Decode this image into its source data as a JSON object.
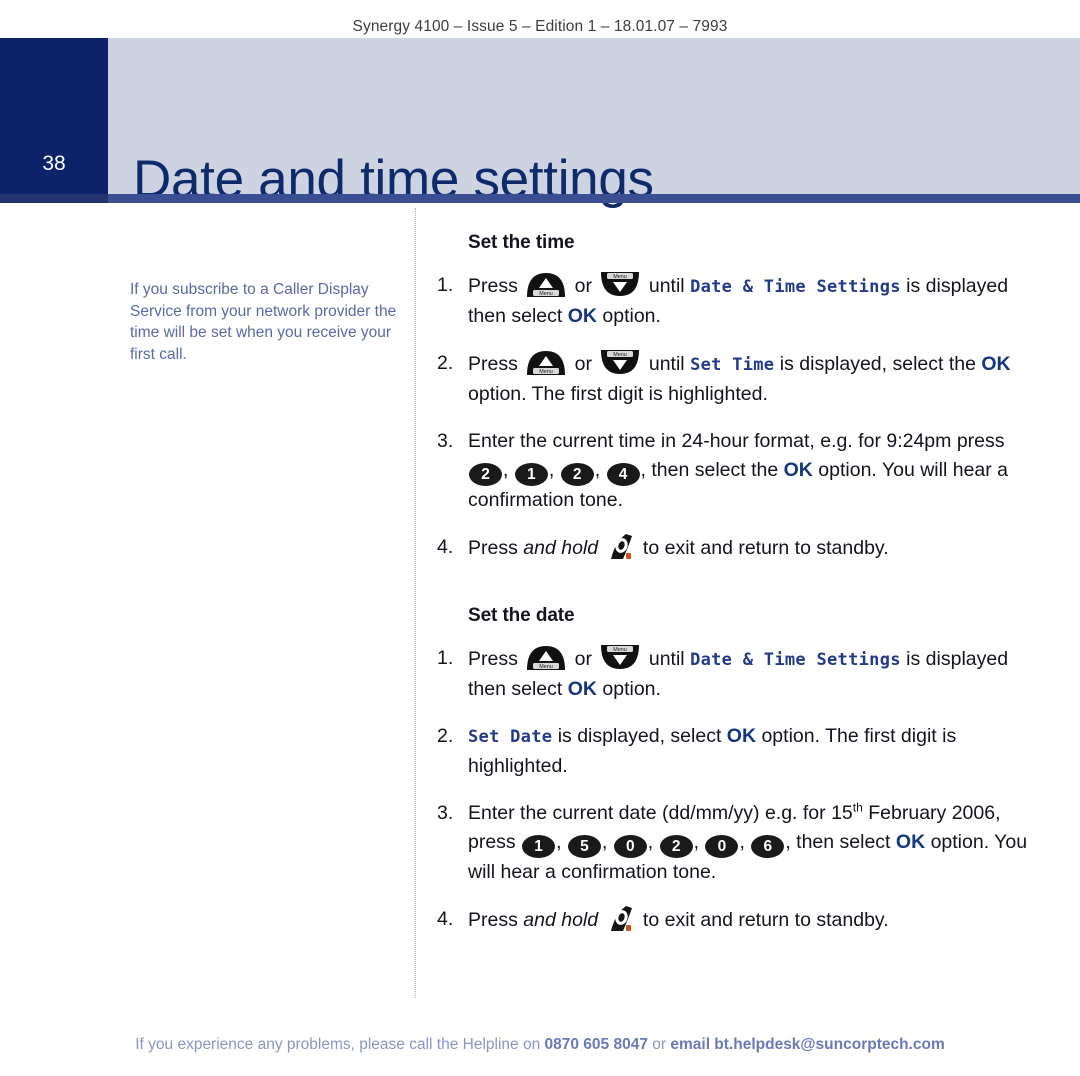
{
  "header": {
    "running_head": "Synergy 4100 – Issue 5 – Edition 1 – 18.01.07 – 7993"
  },
  "banner": {
    "page_number": "38",
    "title": "Date and time settings",
    "bg_color": "#ced3e2",
    "page_box_color": "#0d2369",
    "title_color": "#0d2a6b",
    "rule_color": "#3a4f91"
  },
  "side_note": {
    "text": "If you subscribe to a Caller Display Service from your network provider the time will be set when you receive your first call.",
    "color": "#5a6aa8"
  },
  "sections": [
    {
      "heading": "Set the time",
      "steps": [
        {
          "number": "1.",
          "parts": [
            {
              "type": "text",
              "value": "Press "
            },
            {
              "type": "icon",
              "icon": "menu-up-key",
              "label": "Menu"
            },
            {
              "type": "text",
              "value": " or "
            },
            {
              "type": "icon",
              "icon": "menu-down-key",
              "label": "Menu"
            },
            {
              "type": "text",
              "value": " until "
            },
            {
              "type": "lcd",
              "value": "Date & Time Settings"
            },
            {
              "type": "text",
              "value": " is displayed then select "
            },
            {
              "type": "ok",
              "value": "OK"
            },
            {
              "type": "text",
              "value": " option."
            }
          ]
        },
        {
          "number": "2.",
          "parts": [
            {
              "type": "text",
              "value": "Press "
            },
            {
              "type": "icon",
              "icon": "menu-up-key",
              "label": "Menu"
            },
            {
              "type": "text",
              "value": " or "
            },
            {
              "type": "icon",
              "icon": "menu-down-key",
              "label": "Menu"
            },
            {
              "type": "text",
              "value": " until "
            },
            {
              "type": "lcd",
              "value": "Set Time"
            },
            {
              "type": "text",
              "value": " is displayed, select the "
            },
            {
              "type": "ok",
              "value": "OK"
            },
            {
              "type": "text",
              "value": " option. The first digit is highlighted."
            }
          ]
        },
        {
          "number": "3.",
          "parts": [
            {
              "type": "text",
              "value": "Enter the current time in 24-hour format, e.g. for 9:24pm press "
            },
            {
              "type": "digit",
              "value": "2"
            },
            {
              "type": "text",
              "value": ", "
            },
            {
              "type": "digit",
              "value": "1"
            },
            {
              "type": "text",
              "value": ", "
            },
            {
              "type": "digit",
              "value": "2"
            },
            {
              "type": "text",
              "value": ", "
            },
            {
              "type": "digit",
              "value": "4"
            },
            {
              "type": "text",
              "value": ", then select the "
            },
            {
              "type": "ok",
              "value": "OK"
            },
            {
              "type": "text",
              "value": " option. You will hear a confirmation tone."
            }
          ]
        },
        {
          "number": "4.",
          "parts": [
            {
              "type": "text",
              "value": "Press "
            },
            {
              "type": "italic",
              "value": "and hold"
            },
            {
              "type": "text",
              "value": " "
            },
            {
              "type": "icon",
              "icon": "hangup-handset-key"
            },
            {
              "type": "text",
              "value": " to exit and return to standby."
            }
          ]
        }
      ]
    },
    {
      "heading": "Set the date",
      "steps": [
        {
          "number": "1.",
          "parts": [
            {
              "type": "text",
              "value": "Press "
            },
            {
              "type": "icon",
              "icon": "menu-up-key",
              "label": "Menu"
            },
            {
              "type": "text",
              "value": " or "
            },
            {
              "type": "icon",
              "icon": "menu-down-key",
              "label": "Menu"
            },
            {
              "type": "text",
              "value": " until "
            },
            {
              "type": "lcd",
              "value": "Date & Time Settings"
            },
            {
              "type": "text",
              "value": " is displayed then select "
            },
            {
              "type": "ok",
              "value": "OK"
            },
            {
              "type": "text",
              "value": " option."
            }
          ]
        },
        {
          "number": "2.",
          "parts": [
            {
              "type": "lcd",
              "value": "Set Date"
            },
            {
              "type": "text",
              "value": " is displayed, select "
            },
            {
              "type": "ok",
              "value": "OK"
            },
            {
              "type": "text",
              "value": " option. The first digit is highlighted."
            }
          ]
        },
        {
          "number": "3.",
          "parts": [
            {
              "type": "text",
              "value": "Enter the current date (dd/mm/yy) e.g. for 15"
            },
            {
              "type": "sup",
              "value": "th"
            },
            {
              "type": "text",
              "value": " February 2006, press "
            },
            {
              "type": "digit",
              "value": "1"
            },
            {
              "type": "text",
              "value": ", "
            },
            {
              "type": "digit",
              "value": "5"
            },
            {
              "type": "text",
              "value": ", "
            },
            {
              "type": "digit",
              "value": "0"
            },
            {
              "type": "text",
              "value": ", "
            },
            {
              "type": "digit",
              "value": "2"
            },
            {
              "type": "text",
              "value": ", "
            },
            {
              "type": "digit",
              "value": "0"
            },
            {
              "type": "text",
              "value": ", "
            },
            {
              "type": "digit",
              "value": "6"
            },
            {
              "type": "text",
              "value": ", then select "
            },
            {
              "type": "ok",
              "value": "OK"
            },
            {
              "type": "text",
              "value": " option. You will hear a confirmation tone."
            }
          ]
        },
        {
          "number": "4.",
          "parts": [
            {
              "type": "text",
              "value": "Press "
            },
            {
              "type": "italic",
              "value": "and hold"
            },
            {
              "type": "text",
              "value": " "
            },
            {
              "type": "icon",
              "icon": "hangup-handset-key"
            },
            {
              "type": "text",
              "value": " to exit and return to standby."
            }
          ]
        }
      ]
    }
  ],
  "footer": {
    "prefix": "If you experience any problems, please call the Helpline on ",
    "phone": "0870 605 8047",
    "middle": " or ",
    "email": "email bt.helpdesk@suncorptech.com",
    "color": "#8a95c6"
  }
}
